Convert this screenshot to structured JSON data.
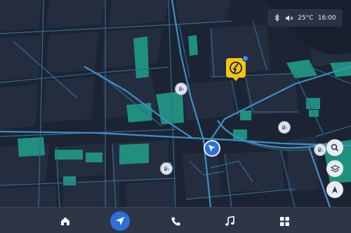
{
  "status_bar": {
    "icons": [
      "bluetooth-icon",
      "speaker-muted-icon"
    ],
    "temperature": "25°C",
    "time": "16:00"
  },
  "map": {
    "theme": "night",
    "colors": {
      "background": "#1c2433",
      "blocks": "#242d3d",
      "roads": "#2f6a96",
      "major_roads": "#3e8ec7",
      "parks": "#1f8f7e",
      "water": "#1a2130"
    },
    "pois": [
      {
        "type": "fuel-station-icon"
      },
      {
        "type": "fuel-station-icon"
      },
      {
        "type": "fuel-station-icon"
      },
      {
        "type": "fuel-station-icon"
      }
    ],
    "featured_poi": {
      "type": "ev-charging-icon",
      "color": "#f2c516",
      "badge_color": "#3a8cf0"
    },
    "vehicle": {
      "type": "navigation-arrow-icon",
      "color": "#2f6fd8"
    }
  },
  "map_controls": [
    "search-icon",
    "layers-icon",
    "compass-icon"
  ],
  "nav_bar": {
    "items": [
      "home-icon",
      "navigation-icon",
      "phone-icon",
      "music-icon",
      "apps-icon"
    ],
    "active": "navigation-icon",
    "accent": "#2f6fd8"
  }
}
